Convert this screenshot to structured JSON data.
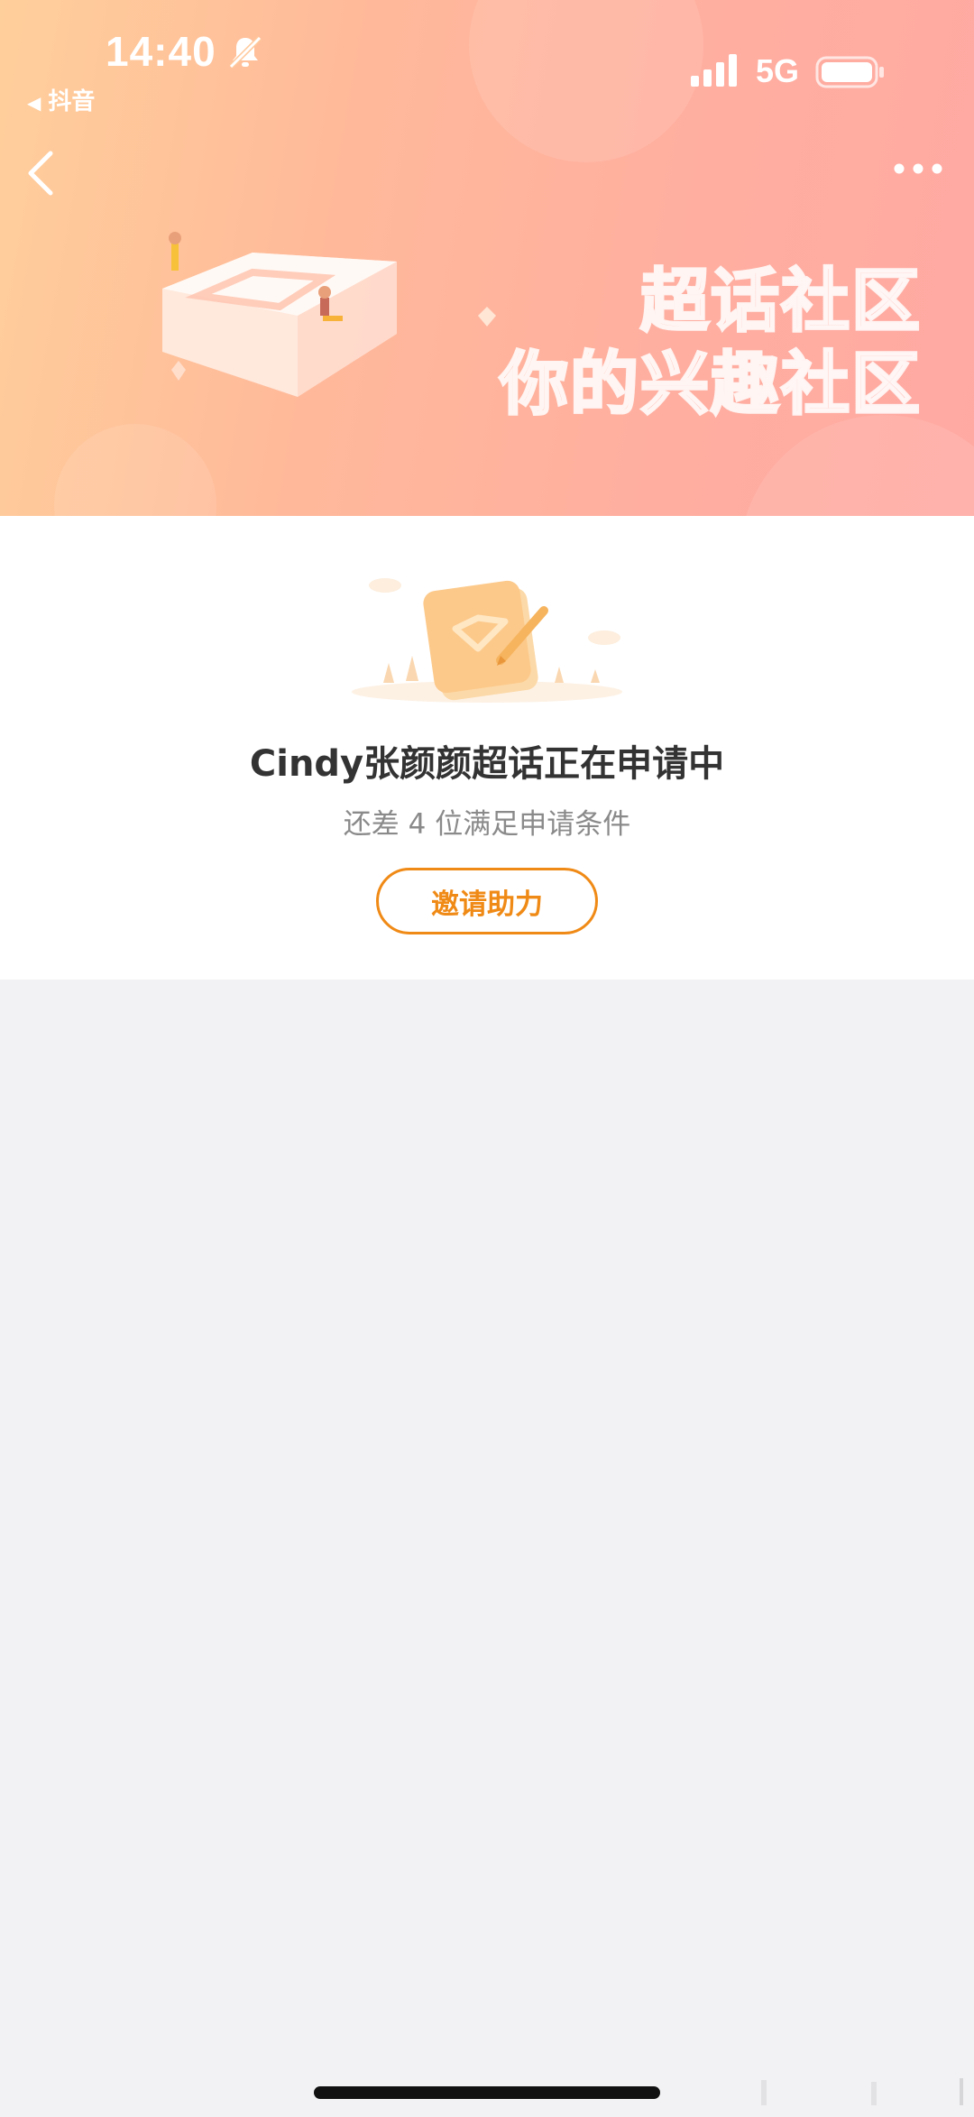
{
  "status_bar": {
    "time": "14:40",
    "back_app": "抖音",
    "network": "5G",
    "icons": [
      "bell-muted-icon",
      "signal-icon",
      "battery-icon"
    ]
  },
  "nav": {
    "back_icon": "chevron-left-icon",
    "more_icon": "more-dots-icon"
  },
  "banner": {
    "slogan_line1": "超话社区",
    "slogan_line2": "你的兴趣社区"
  },
  "card": {
    "title": "Cindy张颜颜超话正在申请中",
    "subtitle": "还差 4 位满足申请条件",
    "button_label": "邀请助力"
  },
  "colors": {
    "accent": "#f08a16",
    "banner_start": "#ffcf9b",
    "banner_end": "#ffa9a2",
    "page_bg": "#f2f2f4"
  }
}
